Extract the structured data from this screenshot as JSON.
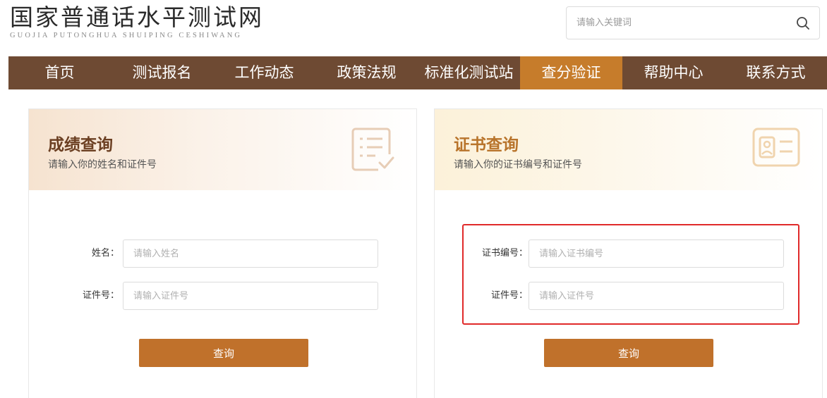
{
  "header": {
    "logo_cn": "国家普通话水平测试网",
    "logo_en": "GUOJIA PUTONGHUA SHUIPING CESHIWANG",
    "search_placeholder": "请输入关键词",
    "search_icon": "search-icon"
  },
  "nav": {
    "items": [
      {
        "label": "首页",
        "active": false
      },
      {
        "label": "测试报名",
        "active": false
      },
      {
        "label": "工作动态",
        "active": false
      },
      {
        "label": "政策法规",
        "active": false
      },
      {
        "label": "标准化测试站",
        "active": false
      },
      {
        "label": "查分验证",
        "active": true
      },
      {
        "label": "帮助中心",
        "active": false
      },
      {
        "label": "联系方式",
        "active": false
      }
    ],
    "bg_color": "#6e4a33",
    "active_color": "#c67c2b"
  },
  "score_query": {
    "title": "成绩查询",
    "subtitle": "请输入你的姓名和证件号",
    "icon": "document-check-icon",
    "name_label": "姓名：",
    "name_placeholder": "请输入姓名",
    "id_label": "证件号：",
    "id_placeholder": "请输入证件号",
    "submit_label": "查询"
  },
  "cert_query": {
    "title": "证书查询",
    "subtitle": "请输入你的证书编号和证件号",
    "icon": "id-card-icon",
    "cert_label": "证书编号：",
    "cert_placeholder": "请输入证书编号",
    "id_label": "证件号：",
    "id_placeholder": "请输入证件号",
    "submit_label": "查询"
  },
  "colors": {
    "button": "#c0712b",
    "highlight": "#e02a2a"
  }
}
